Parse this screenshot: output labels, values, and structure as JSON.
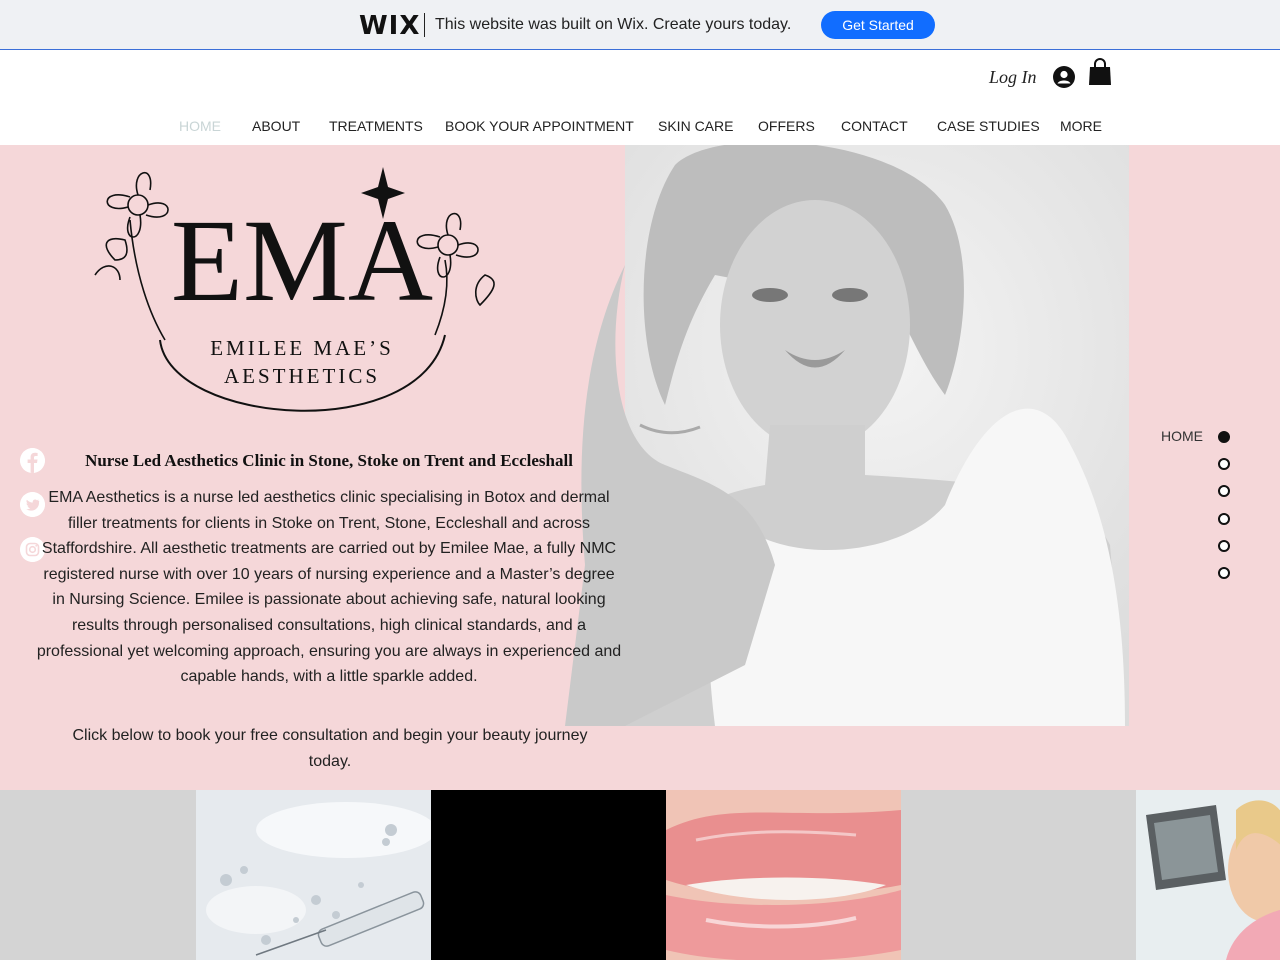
{
  "wix_banner": {
    "logo": "WIX",
    "message": "This website was built on Wix. Create yours today.",
    "button": "Get Started"
  },
  "header": {
    "login": "Log In",
    "nav": [
      {
        "label": "HOME",
        "active": true
      },
      {
        "label": "ABOUT"
      },
      {
        "label": "TREATMENTS"
      },
      {
        "label": "BOOK YOUR APPOINTMENT"
      },
      {
        "label": "SKIN CARE"
      },
      {
        "label": "OFFERS"
      },
      {
        "label": "CONTACT"
      },
      {
        "label": "CASE STUDIES"
      },
      {
        "label": "MORE"
      }
    ]
  },
  "logo": {
    "monogram": "EMA",
    "line1": "EMILEE MAE’S",
    "line2": "AESTHETICS"
  },
  "social": [
    "facebook-icon",
    "twitter-icon",
    "instagram-icon"
  ],
  "hero": {
    "headline": "Nurse Led Aesthetics Clinic in Stone, Stoke on Trent and Eccleshall",
    "body": "EMA Aesthetics is a nurse led aesthetics clinic specialising in Botox and dermal filler treatments for clients in Stoke on Trent, Stone, Eccleshall and across Staffordshire. All aesthetic treatments are carried out by Emilee Mae, a fully NMC registered nurse with over 10 years of nursing experience and a Master’s degree in Nursing Science. Emilee is passionate about achieving safe, natural looking results through personalised consultations, high clinical standards, and a professional yet welcoming approach, ensuring you are always in experienced and capable hands, with a little sparkle added.",
    "cta": "Click below to book your free consultation and begin your beauty journey today."
  },
  "anchor_menu": {
    "label": "HOME",
    "dots": 6,
    "active_index": 0
  },
  "colors": {
    "hero_bg": "#f5d7d9",
    "wix_button": "#116dff",
    "nav_active": "#c9d5d6"
  }
}
